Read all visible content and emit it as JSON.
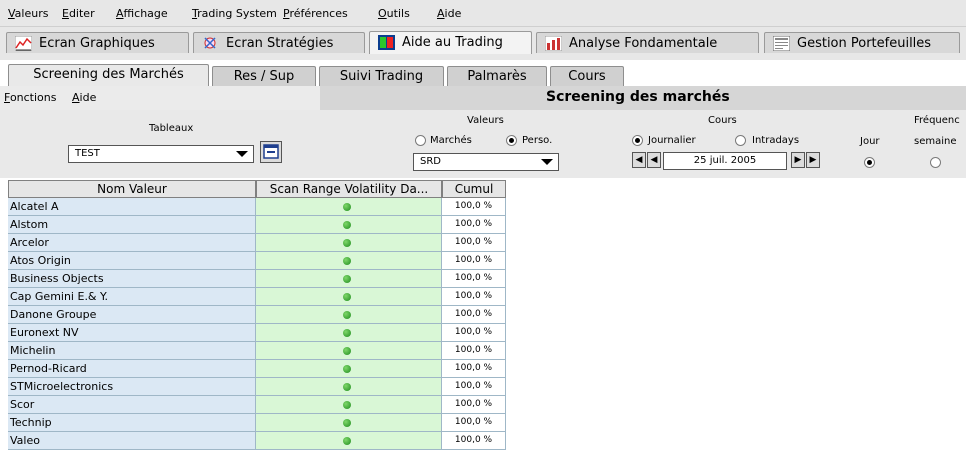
{
  "menu": [
    "Valeurs",
    "Editer",
    "Affichage",
    "Trading System",
    "Préférences",
    "Outils",
    "Aide"
  ],
  "main_tabs": [
    "Ecran Graphiques",
    "Ecran Stratégies",
    "Aide au Trading",
    "Analyse Fondamentale",
    "Gestion Portefeuilles"
  ],
  "sub_tabs": [
    "Screening des Marchés",
    "Res / Sup",
    "Suivi Trading",
    "Palmarès",
    "Cours"
  ],
  "functions_menu": [
    "Fonctions",
    "Aide"
  ],
  "screen_title": "Screening des marchés",
  "tableaux": {
    "label": "Tableaux",
    "selected": "TEST"
  },
  "valeurs": {
    "label": "Valeurs",
    "option_marches": "Marchés",
    "option_perso": "Perso.",
    "selected_list": "SRD"
  },
  "cours": {
    "label": "Cours",
    "option_journalier": "Journalier",
    "option_intradays": "Intradays",
    "date": "25 juil. 2005"
  },
  "frequence": {
    "label": "Fréquenc",
    "jour": "Jour",
    "semaine": "semaine"
  },
  "table": {
    "columns": [
      "Nom Valeur",
      "Scan Range Volatility Da...",
      "Cumul"
    ],
    "rows": [
      {
        "name": "Alcatel A",
        "cumul": "100,0 %"
      },
      {
        "name": "Alstom",
        "cumul": "100,0 %"
      },
      {
        "name": "Arcelor",
        "cumul": "100,0 %"
      },
      {
        "name": "Atos Origin",
        "cumul": "100,0 %"
      },
      {
        "name": "Business Objects",
        "cumul": "100,0 %"
      },
      {
        "name": "Cap Gemini E.& Y.",
        "cumul": "100,0 %"
      },
      {
        "name": "Danone Groupe",
        "cumul": "100,0 %"
      },
      {
        "name": "Euronext NV",
        "cumul": "100,0 %"
      },
      {
        "name": "Michelin",
        "cumul": "100,0 %"
      },
      {
        "name": "Pernod-Ricard",
        "cumul": "100,0 %"
      },
      {
        "name": "STMicroelectronics",
        "cumul": "100,0 %"
      },
      {
        "name": "Scor",
        "cumul": "100,0 %"
      },
      {
        "name": "Technip",
        "cumul": "100,0 %"
      },
      {
        "name": "Valeo",
        "cumul": "100,0 %"
      }
    ]
  }
}
